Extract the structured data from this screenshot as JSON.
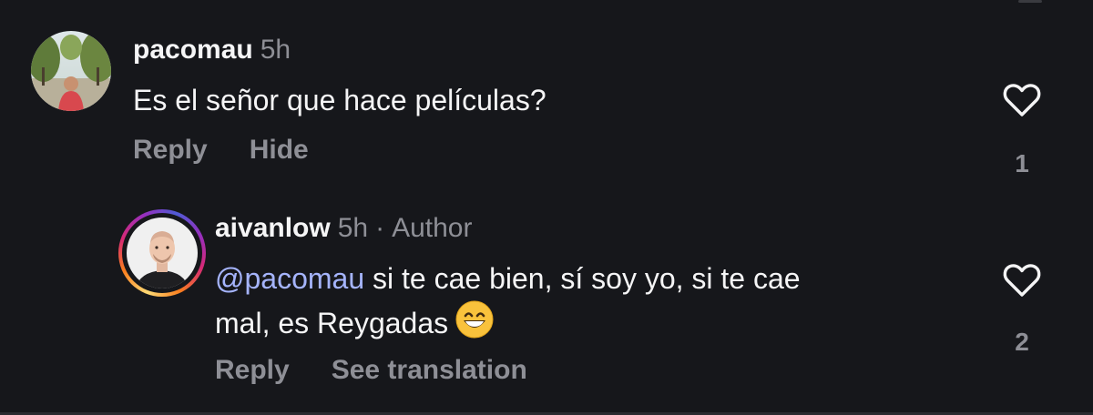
{
  "comments": [
    {
      "username": "pacomau",
      "time": "5h",
      "text": "Es el señor que hace películas?",
      "actions": [
        "Reply",
        "Hide"
      ],
      "like_count": "1"
    }
  ],
  "reply": {
    "username": "aivanlow",
    "time": "5h",
    "separator": "·",
    "author_badge": "Author",
    "mention": "@pacomau",
    "text_line1": " si te cae bien, sí soy yo, si te cae",
    "text_line2": "mal, es Reygadas",
    "emoji": "grinning-face-with-smiling-eyes-emoji",
    "actions": [
      "Reply",
      "See translation"
    ],
    "like_count": "2"
  },
  "colors": {
    "background": "#16171b",
    "text_primary": "#f5f5f6",
    "text_secondary": "#8e8f96",
    "mention": "#a5b4fc",
    "story_ring": [
      "#feda75",
      "#fa7e1e",
      "#d62976",
      "#962fbf"
    ]
  }
}
